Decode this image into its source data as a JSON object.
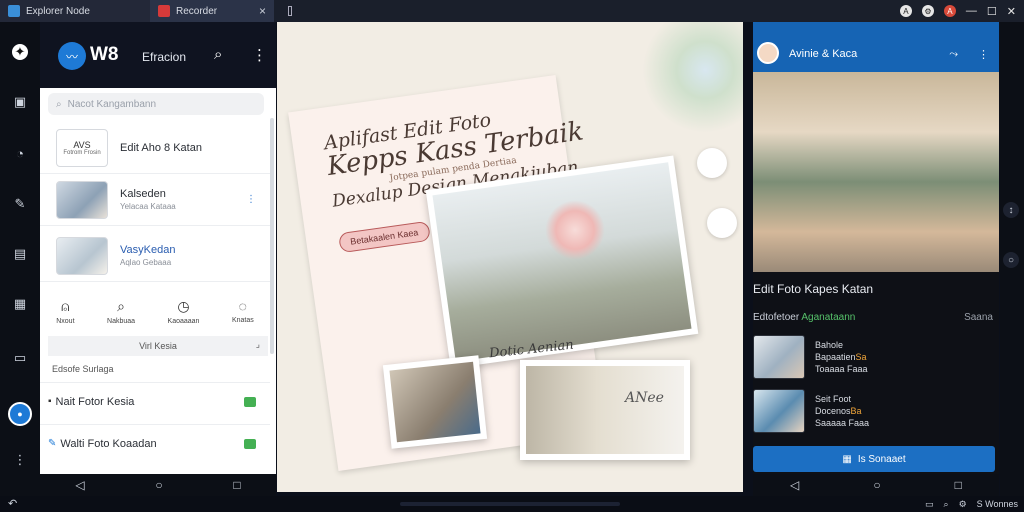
{
  "window": {
    "tabs": [
      {
        "label": "Explorer Node",
        "color": "#3a8fd8"
      },
      {
        "label": "Recorder",
        "color": "#d63a3a"
      }
    ],
    "top_right": {
      "badge1": "A",
      "badge2": "A"
    }
  },
  "left_app": {
    "brand": "W8",
    "title": "Efracion",
    "search_placeholder": "Nacot Kangambann",
    "rows": [
      {
        "title": "Edit Aho 8 Katan",
        "sub": ""
      },
      {
        "title": "Kalseden",
        "sub": "Yelacaa Kataaa"
      },
      {
        "title": "VasyKedan",
        "sub": "Aqlao Gebaaa"
      }
    ],
    "row_badge": "AVS",
    "row_badge_sub": "Fotrom Frosin",
    "actions": [
      "Nxout",
      "Nakbuaa",
      "Kaoaaaan",
      "Knatas"
    ],
    "section_bar": "Virl Kesia",
    "section_label": "Edsofe Surlaga",
    "simple_rows": [
      "Nait Fotor Kesia",
      "Walti Foto Koaadan"
    ]
  },
  "canvas": {
    "headline_1": "Aplifast Edit Foto",
    "headline_2": "Kepps Kass Terbaik",
    "headline_3": "Dexalup Design Menakjuban",
    "headline_sub": "Jotpea pulam penda Dertiaa",
    "pill": "Betakaalen Kaea",
    "small_title": "Dotic Aenian",
    "caption": "ANee"
  },
  "right_app": {
    "title": "Avinie & Kaca",
    "heading": "Edit Foto Kapes Katan",
    "section_left": "Edtofetoer",
    "section_green": "Aganataann",
    "section_more": "Saana",
    "items": [
      {
        "line1": "Bahole",
        "line2": "Bapaatien",
        "line2_orange": "Sa",
        "line3": "Toaaaa Faaa"
      },
      {
        "line1": "Seit Foot",
        "line2": "Docenos",
        "line2_orange": "Ba",
        "line3": "Saaaaa Faaa"
      }
    ],
    "button": "Is Sonaaet"
  },
  "taskbar": {
    "right": "S Wonnes"
  }
}
